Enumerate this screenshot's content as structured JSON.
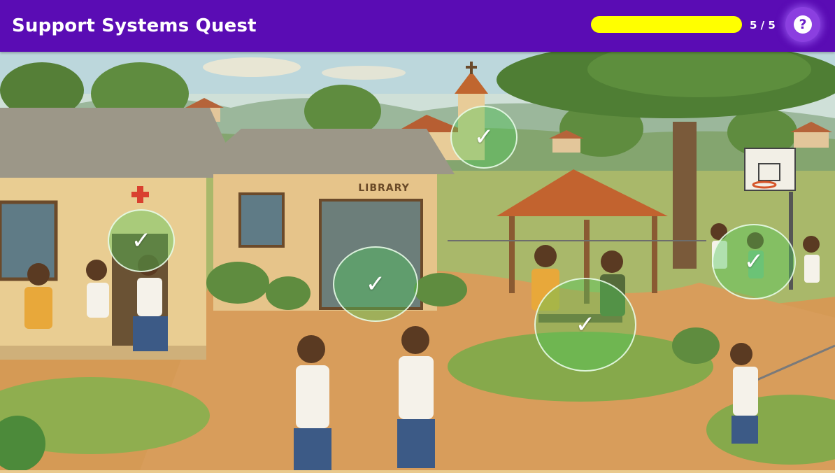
{
  "header": {
    "title": "Support Systems Quest",
    "progress_fraction": 1.0,
    "counter": "5 / 5",
    "help_icon": "help-icon",
    "help_glyph": "?"
  },
  "scene": {
    "sign_text": "LIBRARY",
    "check_glyph": "✓",
    "hotspots": [
      {
        "name": "church",
        "found": true
      },
      {
        "name": "clinic",
        "found": true
      },
      {
        "name": "library",
        "found": true
      },
      {
        "name": "gazebo-counselor",
        "found": true
      },
      {
        "name": "playground-friend",
        "found": true
      }
    ]
  },
  "colors": {
    "header_bg": "#5a0cb4",
    "progress": "#ffff00",
    "help_button": "#8b3fe0",
    "hotspot_found": "#50c85a"
  }
}
